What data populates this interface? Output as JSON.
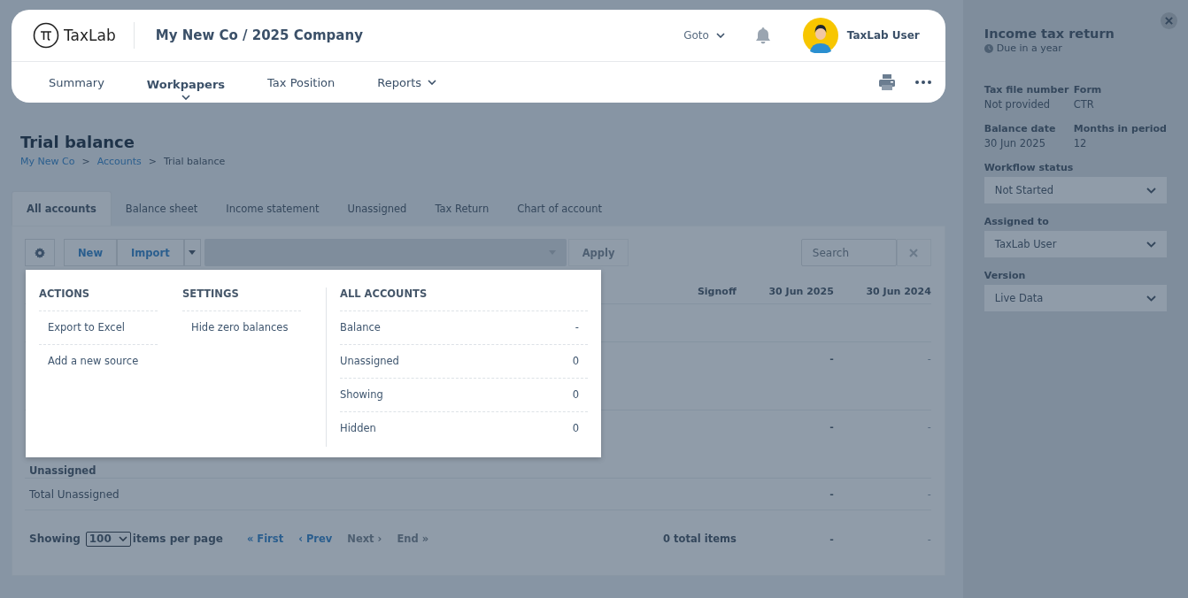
{
  "header": {
    "logo": "TaxLab",
    "company": "My New Co / 2025 Company",
    "goto": "Goto",
    "user": "TaxLab User",
    "nav": [
      {
        "label": "Summary",
        "selected": false,
        "dropdown": false
      },
      {
        "label": "Workpapers",
        "selected": true,
        "dropdown": true
      },
      {
        "label": "Tax Position",
        "selected": false,
        "dropdown": false
      },
      {
        "label": "Reports",
        "selected": false,
        "dropdown": true
      }
    ]
  },
  "page": {
    "title": "Trial balance",
    "separator": ">",
    "breadcrumb": [
      {
        "label": "My New Co",
        "link": true
      },
      {
        "label": "Accounts",
        "link": true
      },
      {
        "label": "Trial balance",
        "link": false
      }
    ]
  },
  "tabs": [
    {
      "label": "All accounts",
      "selected": true
    },
    {
      "label": "Balance sheet",
      "selected": false
    },
    {
      "label": "Income statement",
      "selected": false
    },
    {
      "label": "Unassigned",
      "selected": false
    },
    {
      "label": "Tax Return",
      "selected": false
    },
    {
      "label": "Chart of account",
      "selected": false
    }
  ],
  "toolbar": {
    "buttons": [
      "New",
      "Import"
    ],
    "apply": "Apply",
    "search_placeholder": "Search"
  },
  "table": {
    "columns": [
      "Signoff",
      "30 Jun 2025",
      "30 Jun 2024"
    ],
    "rows": [
      {
        "kind": "blank"
      },
      {
        "kind": "values",
        "values": [
          "-",
          "-"
        ]
      },
      {
        "kind": "group",
        "label": "Unassigned",
        "values": [
          "-",
          "-"
        ]
      },
      {
        "kind": "total",
        "label": "Total Unassigned",
        "values": [
          "-",
          "-"
        ]
      }
    ]
  },
  "footer": {
    "showing": "Showing",
    "page_size": "100",
    "per_page": "items per page",
    "pager": [
      {
        "label": "« First",
        "enabled": true
      },
      {
        "label": "‹ Prev",
        "enabled": true
      },
      {
        "label": "Next ›",
        "enabled": false
      },
      {
        "label": "End »",
        "enabled": false
      }
    ],
    "total": "0 total items",
    "values": [
      "-",
      "-"
    ]
  },
  "menu": {
    "actions": {
      "heading": "ACTIONS",
      "items": [
        "Export to Excel",
        "Add a new source"
      ]
    },
    "settings": {
      "heading": "SETTINGS",
      "items": [
        "Hide zero balances"
      ]
    },
    "accounts": {
      "heading": "ALL ACCOUNTS",
      "rows": [
        {
          "label": "Balance",
          "value": "-"
        },
        {
          "label": "Unassigned",
          "value": "0"
        },
        {
          "label": "Showing",
          "value": "0"
        },
        {
          "label": "Hidden",
          "value": "0"
        }
      ]
    }
  },
  "side": {
    "title": "Income tax return",
    "due": "Due in a year",
    "fields": [
      {
        "label": "Tax file number",
        "value": "Not provided"
      },
      {
        "label": "Form",
        "value": "CTR"
      },
      {
        "label": "Balance date",
        "value": "30 Jun 2025"
      },
      {
        "label": "Months in period",
        "value": "12"
      }
    ],
    "selects": [
      {
        "label": "Workflow status",
        "value": "Not Started"
      },
      {
        "label": "Assigned to",
        "value": "TaxLab User"
      },
      {
        "label": "Version",
        "value": "Live Data"
      }
    ]
  }
}
